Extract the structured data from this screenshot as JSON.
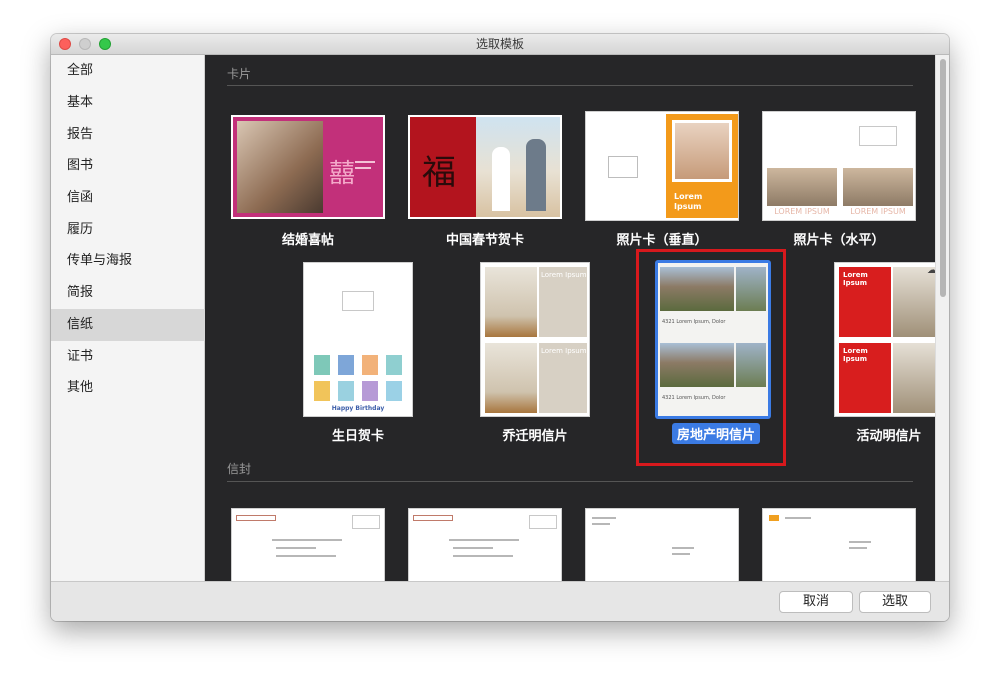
{
  "window": {
    "title": "选取模板"
  },
  "sidebar": {
    "items": [
      {
        "label": "全部"
      },
      {
        "label": "基本"
      },
      {
        "label": "报告"
      },
      {
        "label": "图书"
      },
      {
        "label": "信函"
      },
      {
        "label": "履历"
      },
      {
        "label": "传单与海报"
      },
      {
        "label": "简报"
      },
      {
        "label": "信纸",
        "selected": true
      },
      {
        "label": "证书"
      },
      {
        "label": "其他"
      }
    ]
  },
  "sections": [
    {
      "title": "卡片"
    },
    {
      "title": "信封"
    }
  ],
  "cards": [
    {
      "label": "结婚喜帖",
      "art_text": "囍"
    },
    {
      "label": "中国春节贺卡",
      "art_text": "福"
    },
    {
      "label": "照片卡（垂直）",
      "art_text": "Lorem Ipsum"
    },
    {
      "label": "照片卡（水平）",
      "art_text": "LOREM IPSUM"
    },
    {
      "label": "生日贺卡",
      "art_text": "Happy Birthday"
    },
    {
      "label": "乔迁明信片",
      "art_text": "Lorem Ipsum"
    },
    {
      "label": "房地产明信片",
      "art_text": "4321 Lorem Ipsum, Dolor",
      "selected": true
    },
    {
      "label": "活动明信片",
      "art_text": "Lorem Ipsum"
    }
  ],
  "buttons": {
    "cancel": "取消",
    "choose": "选取"
  },
  "colors": {
    "accent": "#3b7be4",
    "highlight": "#d7191d",
    "content_bg": "#262628"
  }
}
